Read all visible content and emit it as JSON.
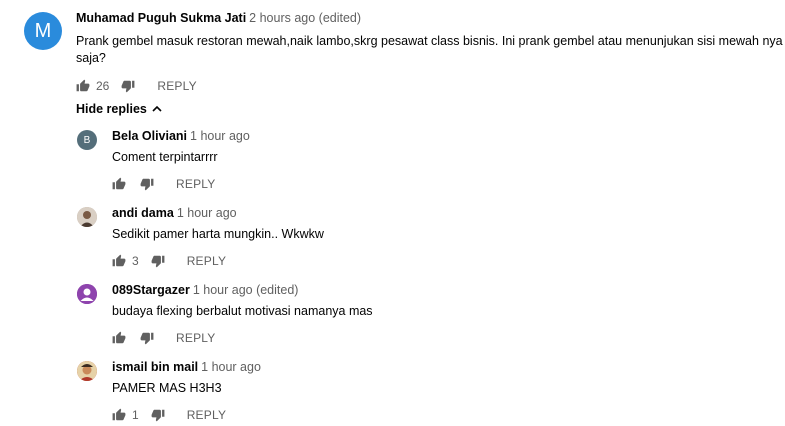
{
  "main_comment": {
    "avatar_letter": "M",
    "avatar_color": "#2a8bdc",
    "author": "Muhamad Puguh Sukma Jati",
    "time": "2 hours ago (edited)",
    "text_line1": "Prank gembel masuk restoran mewah,naik lambo,skrg pesawat class  bisnis. Ini prank gembel atau menunjukan sisi mewah nya",
    "text_line2": "saja?",
    "likes": "26",
    "reply_label": "REPLY"
  },
  "hide_replies_label": "Hide replies",
  "replies": [
    {
      "author": "Bela Oliviani",
      "time": "1 hour ago",
      "text": "Coment terpintarrrr",
      "likes": "",
      "reply_label": "REPLY",
      "avatar_letter": "B",
      "avatar_color": "#546e7a"
    },
    {
      "author": "andi dama",
      "time": "1 hour ago",
      "text": "Sedikit pamer harta mungkin.. Wkwkw",
      "likes": "3",
      "reply_label": "REPLY",
      "avatar_color": "#b8a89a"
    },
    {
      "author": "089Stargazer",
      "time": "1 hour ago (edited)",
      "text": "budaya flexing berbalut motivasi namanya mas",
      "likes": "",
      "reply_label": "REPLY",
      "avatar_color": "#8e44ad"
    },
    {
      "author": "ismail bin mail",
      "time": "1 hour ago",
      "text": "PAMER MAS H3H3",
      "likes": "1",
      "reply_label": "REPLY",
      "avatar_color": "#c0392b"
    }
  ]
}
